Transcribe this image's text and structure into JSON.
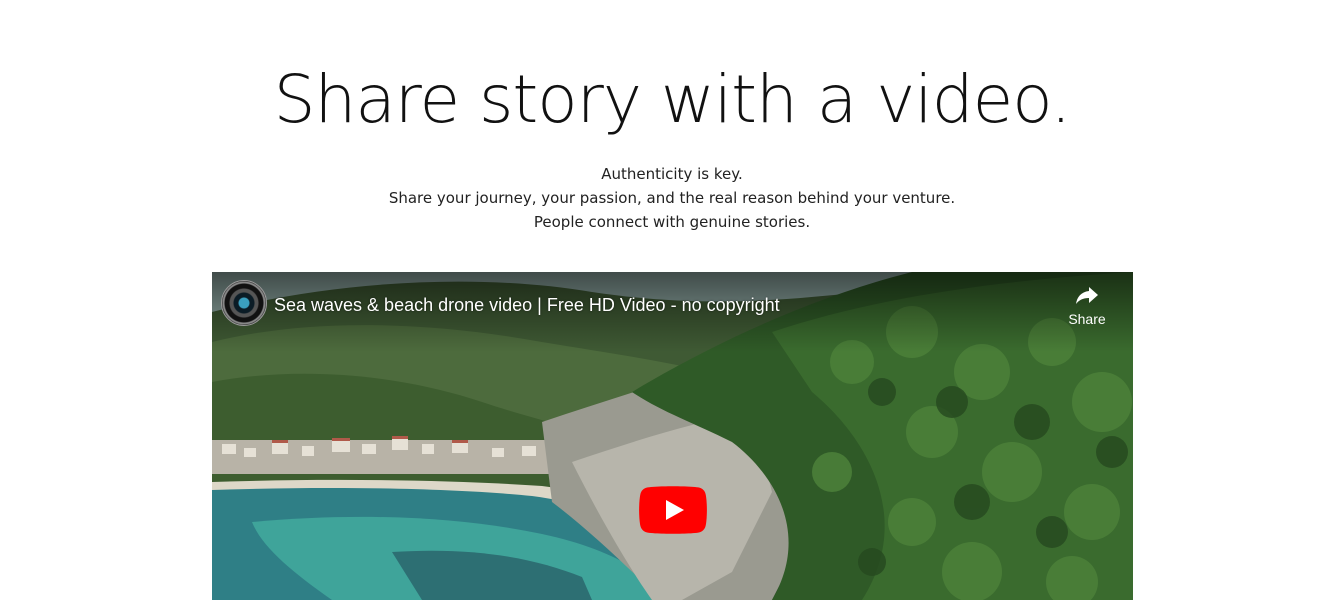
{
  "section": {
    "heading": "Share story with a video.",
    "lines": [
      "Authenticity is key.",
      "Share your journey, your passion, and the real reason behind your venture.",
      "People connect with genuine stories."
    ]
  },
  "video": {
    "title": "Sea waves & beach drone video | Free HD Video - no copyright",
    "share_label": "Share",
    "play_color": "#ff0000",
    "icons": {
      "channel": "channel-avatar",
      "share": "share-arrow-icon",
      "play": "play-icon"
    }
  }
}
